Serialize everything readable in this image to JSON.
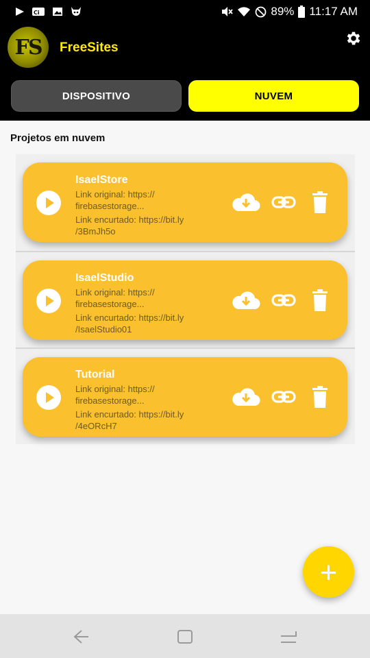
{
  "status_bar": {
    "battery": "89%",
    "time": "11:17 AM"
  },
  "header": {
    "logo_text": "FS",
    "app_name": "FreeSites",
    "tabs": [
      {
        "label": "DISPOSITIVO",
        "active": false
      },
      {
        "label": "NUVEM",
        "active": true
      }
    ]
  },
  "section": {
    "title": "Projetos em nuvem"
  },
  "projects": [
    {
      "name": "IsaelStore",
      "link_original": "Link original: https://\nfirebasestorage...",
      "link_short": "Link encurtado: https://bit.ly\n/3BmJh5o"
    },
    {
      "name": "IsaelStudio",
      "link_original": "Link original: https://\nfirebasestorage...",
      "link_short": "Link encurtado: https://bit.ly\n/IsaelStudio01"
    },
    {
      "name": "Tutorial",
      "link_original": "Link original: https://\nfirebasestorage...",
      "link_short": "Link encurtado: https://bit.ly\n/4eORcH7"
    }
  ],
  "fab": {
    "label": "+"
  },
  "icons": {
    "play": "play-icon",
    "cloud_download": "cloud-download-icon",
    "link": "link-icon",
    "delete": "trash-icon",
    "settings": "gear-icon"
  },
  "colors": {
    "accent": "#ffff00",
    "card": "#fbc02d",
    "fab": "#ffd600",
    "header_bg": "#000000"
  }
}
